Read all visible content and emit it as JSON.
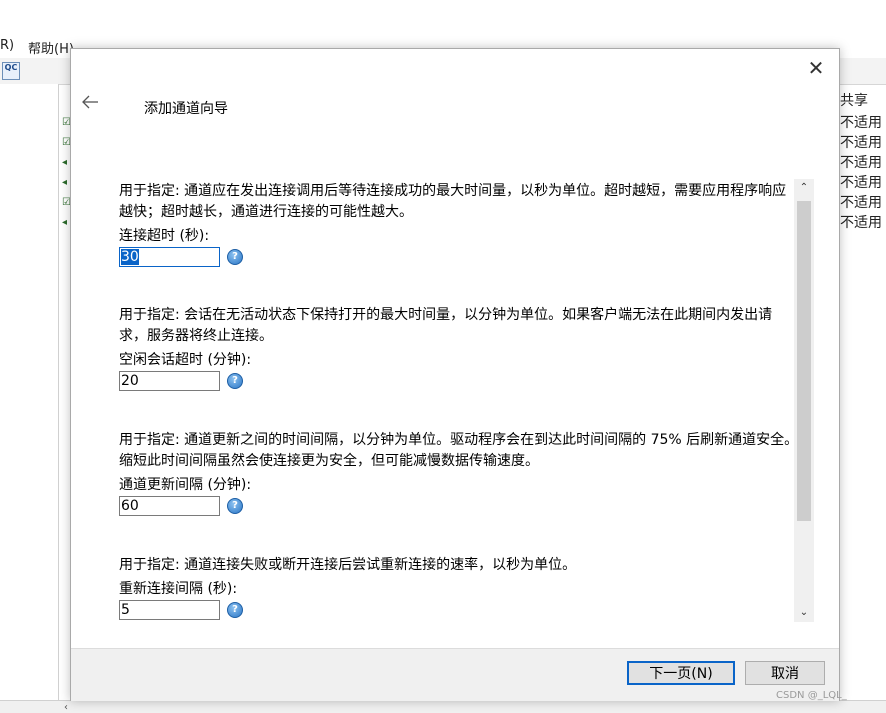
{
  "background": {
    "menu": [
      "R)",
      "帮助(H)"
    ],
    "toolbar_icon_text": "QC",
    "column_header": "共享",
    "cells": [
      "不适用",
      "不适用",
      "不适用",
      "不适用",
      "不适用",
      "不适用"
    ],
    "tree_marks": [
      "☑",
      "☑",
      "◂",
      "◂",
      "☑",
      "◂"
    ]
  },
  "dialog": {
    "title": "添加通道向导",
    "close_glyph": "✕",
    "sections": [
      {
        "desc": "用于指定: 通道应在发出连接调用后等待连接成功的最大时间量，以秒为单位。超时越短，需要应用程序响应越快；超时越长，通道进行连接的可能性越大。",
        "label": "连接超时 (秒):",
        "value": "30"
      },
      {
        "desc": "用于指定: 会话在无活动状态下保持打开的最大时间量，以分钟为单位。如果客户端无法在此期间内发出请求，服务器将终止连接。",
        "label": "空闲会话超时 (分钟):",
        "value": "20"
      },
      {
        "desc": "用于指定: 通道更新之间的时间间隔，以分钟为单位。驱动程序会在到达此时间间隔的 75% 后刷新通道安全。缩短此时间间隔虽然会使连接更为安全，但可能减慢数据传输速度。",
        "label": "通道更新间隔 (分钟):",
        "value": "60"
      },
      {
        "desc": "用于指定: 通道连接失败或断开连接后尝试重新连接的速率，以秒为单位。",
        "label": "重新连接间隔 (秒):",
        "value": "5"
      }
    ],
    "help_glyph": "?",
    "buttons": {
      "next": "下一页(N)",
      "cancel": "取消"
    }
  },
  "watermark": "CSDN @_LQL_"
}
